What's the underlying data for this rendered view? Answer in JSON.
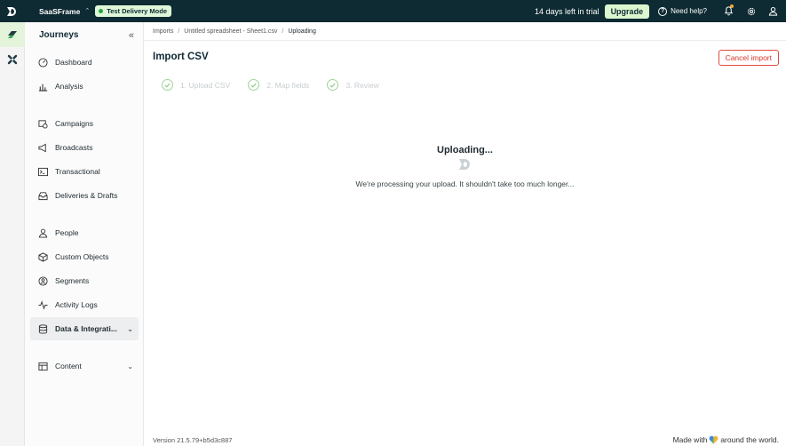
{
  "topbar": {
    "workspace": "SaaSFrame",
    "mode_badge": "Test Delivery Mode",
    "trial_text": "14 days left in trial",
    "upgrade_label": "Upgrade",
    "help_label": "Need help?"
  },
  "sidebar": {
    "title": "Journeys",
    "items": [
      {
        "label": "Dashboard"
      },
      {
        "label": "Analysis"
      },
      {
        "label": "Campaigns"
      },
      {
        "label": "Broadcasts"
      },
      {
        "label": "Transactional"
      },
      {
        "label": "Deliveries & Drafts"
      },
      {
        "label": "People"
      },
      {
        "label": "Custom Objects"
      },
      {
        "label": "Segments"
      },
      {
        "label": "Activity Logs"
      },
      {
        "label": "Data & Integrati..."
      },
      {
        "label": "Content"
      }
    ]
  },
  "breadcrumb": {
    "items": [
      "Imports",
      "Untitled spreadsheet - Sheet1.csv",
      "Uploading"
    ]
  },
  "page": {
    "title": "Import CSV",
    "cancel_label": "Cancel import",
    "steps": [
      "1. Upload CSV",
      "2. Map fields",
      "3. Review"
    ],
    "status_title": "Uploading...",
    "status_message": "We're processing your upload. It shouldn't take too much longer..."
  },
  "footer": {
    "version": "Version 21.5.79+b5d3c887",
    "made_prefix": "Made with",
    "made_suffix": "around the world."
  },
  "colors": {
    "topbar_bg": "#0e2a33",
    "accent_green": "#dcf7cf",
    "danger": "#d7372b"
  }
}
